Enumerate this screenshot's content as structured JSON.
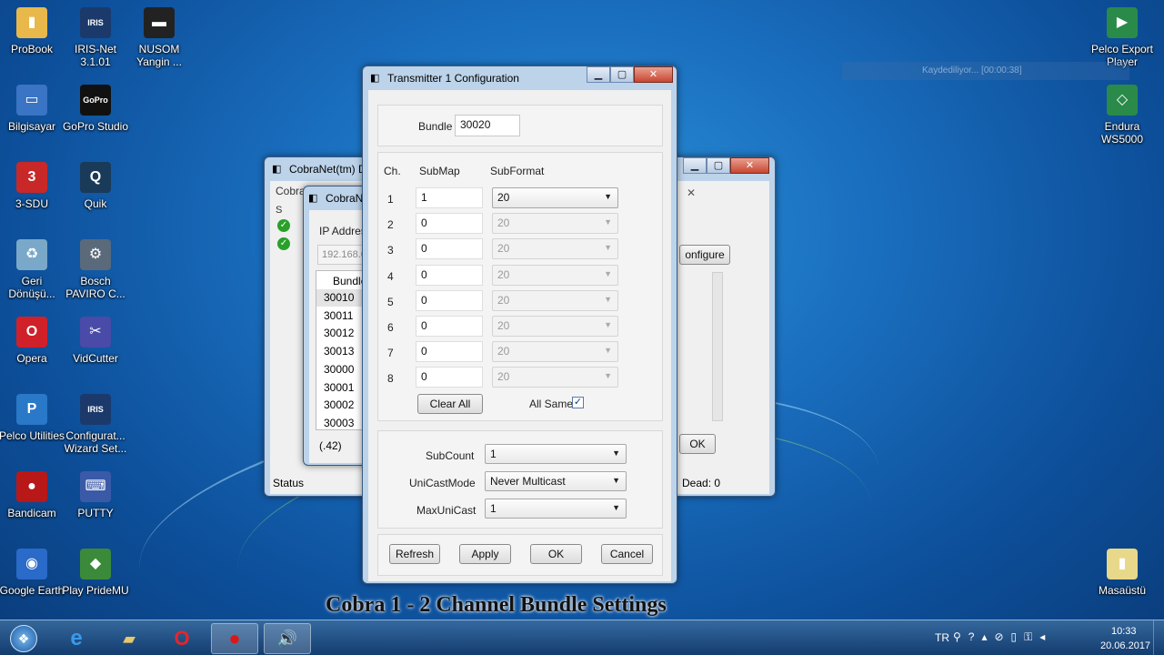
{
  "desktop": {
    "icons_left": [
      {
        "label": "ProBook",
        "glyph": "▮",
        "color": "#e8b84a"
      },
      {
        "label": "IRIS-Net 3.1.01",
        "glyph": "IRIS",
        "color": "#1b3a6b"
      },
      {
        "label": "NUSOM Yangin ...",
        "glyph": "▬",
        "color": "#222222"
      },
      {
        "label": "Bilgisayar",
        "glyph": "▭",
        "color": "#3a74c4"
      },
      {
        "label": "GoPro Studio",
        "glyph": "GoPro",
        "color": "#111111"
      },
      {
        "label": "3-SDU",
        "glyph": "3",
        "color": "#c82828"
      },
      {
        "label": "Quik",
        "glyph": "Q",
        "color": "#1a3a5a"
      },
      {
        "label": "Geri Dönüşü...",
        "glyph": "♻",
        "color": "#7aa8c8"
      },
      {
        "label": "Bosch PAVIRO C...",
        "glyph": "⚙",
        "color": "#5a6a7a"
      },
      {
        "label": "Opera",
        "glyph": "O",
        "color": "#d0202a"
      },
      {
        "label": "VidCutter",
        "glyph": "✂",
        "color": "#4a4aa8"
      },
      {
        "label": "Pelco Utilities",
        "glyph": "P",
        "color": "#2a78c8"
      },
      {
        "label": "Configurat... Wizard Set...",
        "glyph": "IRIS",
        "color": "#1b3a6b"
      },
      {
        "label": "Bandicam",
        "glyph": "●",
        "color": "#b81818"
      },
      {
        "label": "PUTTY",
        "glyph": "⌨",
        "color": "#3a5aa8"
      },
      {
        "label": "Google Earth",
        "glyph": "◉",
        "color": "#2a6ac8"
      },
      {
        "label": "Play PrideMU",
        "glyph": "◆",
        "color": "#3a8a3a"
      }
    ],
    "icons_right": [
      {
        "label": "Pelco Export Player",
        "glyph": "▶",
        "color": "#2a8a4a"
      },
      {
        "label": "Endura WS5000",
        "glyph": "◇",
        "color": "#2a8a4a"
      },
      {
        "label": "Masaüstü",
        "glyph": "▮",
        "color": "#e8d88a"
      }
    ],
    "recorder_status": "Kaydediliyor... [00:00:38]"
  },
  "bg_window": {
    "title": "CobraNet(tm) D",
    "tab": "Cobra",
    "col_s": "S",
    "status_left": "Status",
    "status_right": "Dead: 0",
    "configure_label": "onfigure",
    "ok_label": "OK",
    "inner": {
      "title": "CobraN",
      "ip_label": "IP Addres",
      "ip_value": "192.168.0",
      "bundle_header": "Bundle",
      "bundles": [
        "30010",
        "30011",
        "30012",
        "30013",
        "30000",
        "30001",
        "30002",
        "30003"
      ],
      "footer": "(.42)"
    }
  },
  "dialog": {
    "title": "Transmitter 1 Configuration",
    "bundle_label": "Bundle",
    "bundle_value": "30020",
    "headers": {
      "ch": "Ch.",
      "submap": "SubMap",
      "subformat": "SubFormat"
    },
    "rows": [
      {
        "ch": "1",
        "submap": "1",
        "subformat": "20",
        "enabled": true
      },
      {
        "ch": "2",
        "submap": "0",
        "subformat": "20",
        "enabled": false
      },
      {
        "ch": "3",
        "submap": "0",
        "subformat": "20",
        "enabled": false
      },
      {
        "ch": "4",
        "submap": "0",
        "subformat": "20",
        "enabled": false
      },
      {
        "ch": "5",
        "submap": "0",
        "subformat": "20",
        "enabled": false
      },
      {
        "ch": "6",
        "submap": "0",
        "subformat": "20",
        "enabled": false
      },
      {
        "ch": "7",
        "submap": "0",
        "subformat": "20",
        "enabled": false
      },
      {
        "ch": "8",
        "submap": "0",
        "subformat": "20",
        "enabled": false
      }
    ],
    "clear_all": "Clear All",
    "all_same_label": "All Same",
    "all_same_checked": true,
    "subcount_label": "SubCount",
    "subcount_value": "1",
    "unicastmode_label": "UniCastMode",
    "unicastmode_value": "Never Multicast",
    "maxunicast_label": "MaxUniCast",
    "maxunicast_value": "1",
    "buttons": {
      "refresh": "Refresh",
      "apply": "Apply",
      "ok": "OK",
      "cancel": "Cancel"
    }
  },
  "caption": "Cobra 1 - 2 Channel Bundle Settings",
  "taskbar": {
    "lang": "TR",
    "time": "10:33",
    "date": "20.06.2017"
  }
}
